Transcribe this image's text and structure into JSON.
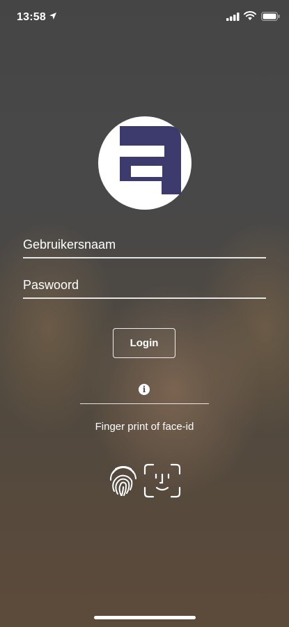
{
  "status_bar": {
    "time": "13:58",
    "location_icon": "location-arrow-icon",
    "signal_icon": "cellular-signal-icon",
    "wifi_icon": "wifi-icon",
    "battery_icon": "battery-icon"
  },
  "logo": {
    "icon": "app-logo-a-icon",
    "brand_color": "#3d3a6e"
  },
  "login_form": {
    "username_placeholder": "Gebruikersnaam",
    "username_value": "",
    "password_placeholder": "Paswoord",
    "password_value": "",
    "login_label": "Login"
  },
  "biometrics": {
    "info_icon": "info-icon",
    "label": "Finger print of face-id",
    "fingerprint_icon": "fingerprint-icon",
    "faceid_icon": "face-id-icon"
  }
}
